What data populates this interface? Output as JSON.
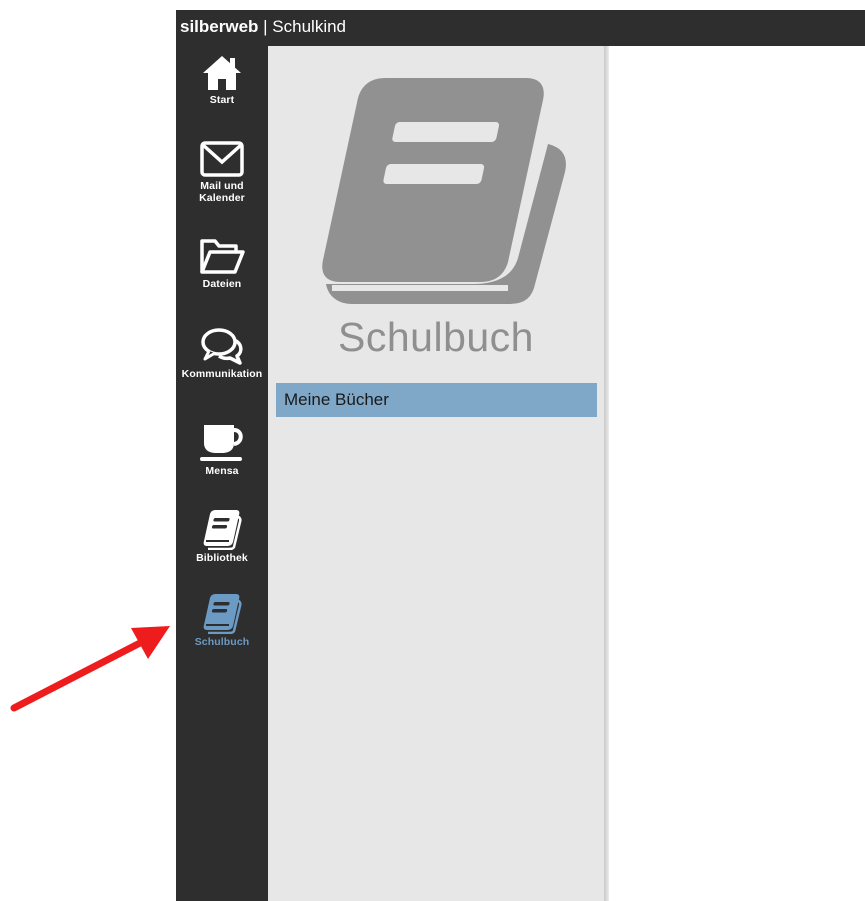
{
  "header": {
    "brand": "silberweb",
    "separator": " | ",
    "context": "Schulkind"
  },
  "nav": {
    "items": [
      {
        "label": "Start",
        "icon": "home-icon"
      },
      {
        "label": "Mail und Kalender",
        "icon": "envelope-icon"
      },
      {
        "label": "Dateien",
        "icon": "folder-icon"
      },
      {
        "label": "Kommunikation",
        "icon": "chat-bubbles-icon"
      },
      {
        "label": "Mensa",
        "icon": "coffee-cup-icon"
      },
      {
        "label": "Bibliothek",
        "icon": "book-icon"
      },
      {
        "label": "Schulbuch",
        "icon": "book-icon",
        "active": true
      }
    ]
  },
  "panel": {
    "title": "Schulbuch",
    "icon": "book-icon",
    "links": [
      {
        "label": "Meine Bücher"
      }
    ]
  },
  "colors": {
    "sidebar": "#2e2e2e",
    "panel": "#e7e7e7",
    "active": "#6b9ac4",
    "link_bg": "#7ea7c8",
    "annotation_arrow": "#ee1c1c"
  }
}
